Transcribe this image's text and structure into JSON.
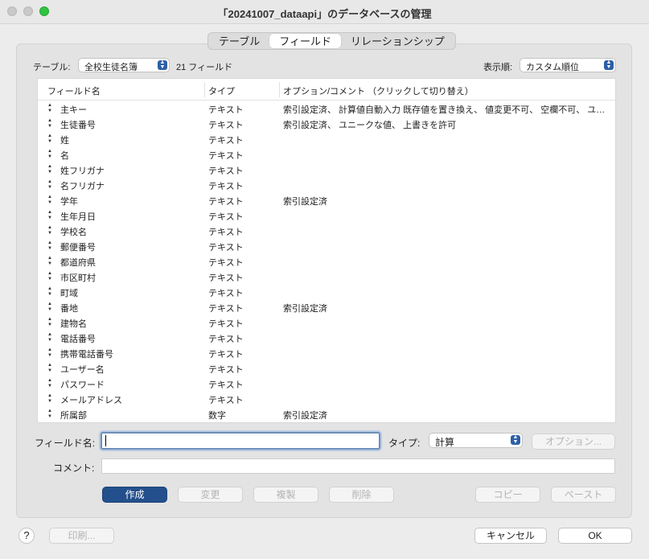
{
  "window": {
    "title": "「20241007_dataapi」のデータベースの管理"
  },
  "tabs": [
    {
      "label": "テーブル",
      "active": false
    },
    {
      "label": "フィールド",
      "active": true
    },
    {
      "label": "リレーションシップ",
      "active": false
    }
  ],
  "toolbar": {
    "table_label": "テーブル:",
    "table_value": "全校生徒名簿",
    "field_count": "21 フィールド",
    "sort_label": "表示順:",
    "sort_value": "カスタム順位"
  },
  "columns": {
    "name": "フィールド名",
    "type": "タイプ",
    "options": "オプション/コメント （クリックして切り替え）"
  },
  "fields": [
    {
      "name": "主キー",
      "type": "テキスト",
      "options": "索引設定済、 計算値自動入力  既存値を置き換え、 値変更不可、 空欄不可、 ユニーク…"
    },
    {
      "name": "生徒番号",
      "type": "テキスト",
      "options": "索引設定済、 ユニークな値、 上書きを許可"
    },
    {
      "name": "姓",
      "type": "テキスト",
      "options": ""
    },
    {
      "name": "名",
      "type": "テキスト",
      "options": ""
    },
    {
      "name": "姓フリガナ",
      "type": "テキスト",
      "options": ""
    },
    {
      "name": "名フリガナ",
      "type": "テキスト",
      "options": ""
    },
    {
      "name": "学年",
      "type": "テキスト",
      "options": "索引設定済"
    },
    {
      "name": "生年月日",
      "type": "テキスト",
      "options": ""
    },
    {
      "name": "学校名",
      "type": "テキスト",
      "options": ""
    },
    {
      "name": "郵便番号",
      "type": "テキスト",
      "options": ""
    },
    {
      "name": "都道府県",
      "type": "テキスト",
      "options": ""
    },
    {
      "name": "市区町村",
      "type": "テキスト",
      "options": ""
    },
    {
      "name": "町域",
      "type": "テキスト",
      "options": ""
    },
    {
      "name": "番地",
      "type": "テキスト",
      "options": "索引設定済"
    },
    {
      "name": "建物名",
      "type": "テキスト",
      "options": ""
    },
    {
      "name": "電話番号",
      "type": "テキスト",
      "options": ""
    },
    {
      "name": "携帯電話番号",
      "type": "テキスト",
      "options": ""
    },
    {
      "name": "ユーザー名",
      "type": "テキスト",
      "options": ""
    },
    {
      "name": "パスワード",
      "type": "テキスト",
      "options": ""
    },
    {
      "name": "メールアドレス",
      "type": "テキスト",
      "options": ""
    },
    {
      "name": "所属部",
      "type": "数字",
      "options": "索引設定済"
    }
  ],
  "editor": {
    "field_name_label": "フィールド名:",
    "field_name_value": "",
    "type_label": "タイプ:",
    "type_value": "計算",
    "options_button": "オプション...",
    "comment_label": "コメント:",
    "comment_value": ""
  },
  "actions": {
    "create": "作成",
    "change": "変更",
    "duplicate": "複製",
    "delete": "削除",
    "copy": "コピー",
    "paste": "ペースト"
  },
  "footer": {
    "help": "?",
    "print": "印刷...",
    "cancel": "キャンセル",
    "ok": "OK"
  },
  "colors": {
    "accent": "#234f8c",
    "popup_arrow": "#2d5fa6",
    "focus_ring": "#6e8fb8"
  }
}
